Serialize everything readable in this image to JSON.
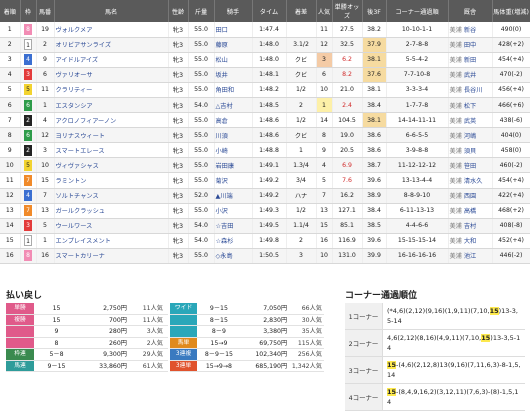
{
  "results": {
    "headers": [
      "着順",
      "枠",
      "馬番",
      "馬名",
      "性齢",
      "斤量",
      "騎手",
      "タイム",
      "着差",
      "人気",
      "単勝オッズ",
      "後3F",
      "コーナー通過順",
      "厩舎",
      "馬体重(増減)"
    ],
    "rows": [
      {
        "rank": "1",
        "waku": "8",
        "num": "19",
        "name": "ヴォルクメア",
        "sexage": "牝3",
        "weight": "55.0",
        "jockey": "田口",
        "time": "1:47.4",
        "margin": "",
        "pop": "11",
        "odds": "27.5",
        "last3f": "38.2",
        "corner": "10-10-1-1",
        "region": "美浦",
        "trainer": "新谷",
        "body": "490(0)"
      },
      {
        "rank": "2",
        "waku": "1",
        "num": "2",
        "name": "オリビアサンライズ",
        "sexage": "牝3",
        "weight": "55.0",
        "jockey": "藤原",
        "time": "1:48.0",
        "margin": "3.1/2",
        "pop": "12",
        "odds": "32.5",
        "last3f": "37.9",
        "corner": "2-7-8-8",
        "region": "美浦",
        "trainer": "田中",
        "body": "428(+2)"
      },
      {
        "rank": "3",
        "waku": "4",
        "num": "9",
        "name": "アイドルアイズ",
        "sexage": "牝3",
        "weight": "55.0",
        "jockey": "松山",
        "time": "1:48.0",
        "margin": "クビ",
        "pop": "3",
        "odds": "6.2",
        "last3f": "38.1",
        "corner": "5-5-4-2",
        "region": "美浦",
        "trainer": "新田",
        "body": "454(+4)"
      },
      {
        "rank": "4",
        "waku": "3",
        "num": "6",
        "name": "ヴァリオーサ",
        "sexage": "牝3",
        "weight": "55.0",
        "jockey": "坂井",
        "time": "1:48.1",
        "margin": "クビ",
        "pop": "6",
        "odds": "8.2",
        "last3f": "37.6",
        "corner": "7-7-10-8",
        "region": "美浦",
        "trainer": "武井",
        "body": "470(-2)"
      },
      {
        "rank": "5",
        "waku": "5",
        "num": "11",
        "name": "クラリティー",
        "sexage": "牝3",
        "weight": "55.0",
        "jockey": "角田和",
        "time": "1:48.2",
        "margin": "1/2",
        "pop": "10",
        "odds": "21.0",
        "last3f": "38.1",
        "corner": "3-3-3-4",
        "region": "美浦",
        "trainer": "長谷川",
        "body": "456(+4)"
      },
      {
        "rank": "6",
        "waku": "6",
        "num": "1",
        "name": "エスタンシア",
        "sexage": "牝3",
        "weight": "54.0",
        "jockey": "△吉村",
        "time": "1:48.5",
        "margin": "2",
        "pop": "1",
        "odds": "2.4",
        "last3f": "38.4",
        "corner": "1-7-7-8",
        "region": "美浦",
        "trainer": "松下",
        "body": "466(+6)"
      },
      {
        "rank": "7",
        "waku": "2",
        "num": "4",
        "name": "アクロノフィアーノン",
        "sexage": "牝3",
        "weight": "55.0",
        "jockey": "高倉",
        "time": "1:48.6",
        "margin": "1/2",
        "pop": "14",
        "odds": "104.5",
        "last3f": "38.1",
        "corner": "14-14-11-11",
        "region": "美浦",
        "trainer": "武英",
        "body": "438(-6)"
      },
      {
        "rank": "8",
        "waku": "6",
        "num": "12",
        "name": "ヨリナスウィート",
        "sexage": "牝3",
        "weight": "55.0",
        "jockey": "川須",
        "time": "1:48.6",
        "margin": "クビ",
        "pop": "8",
        "odds": "19.0",
        "last3f": "38.6",
        "corner": "6-6-5-5",
        "region": "美浦",
        "trainer": "河嶋",
        "body": "404(0)"
      },
      {
        "rank": "9",
        "waku": "2",
        "num": "3",
        "name": "スマートエレース",
        "sexage": "牝3",
        "weight": "55.0",
        "jockey": "小崎",
        "time": "1:48.8",
        "margin": "1",
        "pop": "9",
        "odds": "20.5",
        "last3f": "38.6",
        "corner": "3-9-8-8",
        "region": "美浦",
        "trainer": "須貝",
        "body": "458(0)"
      },
      {
        "rank": "10",
        "waku": "5",
        "num": "10",
        "name": "ヴィヴァシャス",
        "sexage": "牝3",
        "weight": "55.0",
        "jockey": "岩田康",
        "time": "1:49.1",
        "margin": "1.3/4",
        "pop": "4",
        "odds": "6.9",
        "last3f": "38.7",
        "corner": "11-12-12-12",
        "region": "美浦",
        "trainer": "笹田",
        "body": "460(-2)"
      },
      {
        "rank": "11",
        "waku": "7",
        "num": "15",
        "name": "ラミントン",
        "sexage": "牝3",
        "weight": "55.0",
        "jockey": "菊沢",
        "time": "1:49.2",
        "margin": "3/4",
        "pop": "5",
        "odds": "7.6",
        "last3f": "39.6",
        "corner": "13-13-4-4",
        "region": "美浦",
        "trainer": "清水久",
        "body": "454(+4)"
      },
      {
        "rank": "12",
        "waku": "4",
        "num": "7",
        "name": "ソルトチャンス",
        "sexage": "牝3",
        "weight": "52.0",
        "jockey": "▲川端",
        "time": "1:49.2",
        "margin": "ハナ",
        "pop": "7",
        "odds": "16.2",
        "last3f": "38.9",
        "corner": "8-8-9-10",
        "region": "美浦",
        "trainer": "西園",
        "body": "422(+4)"
      },
      {
        "rank": "13",
        "waku": "7",
        "num": "13",
        "name": "ガールクラッシュ",
        "sexage": "牝3",
        "weight": "55.0",
        "jockey": "小沢",
        "time": "1:49.3",
        "margin": "1/2",
        "pop": "13",
        "odds": "127.1",
        "last3f": "38.4",
        "corner": "6-11-13-13",
        "region": "美浦",
        "trainer": "高橋",
        "body": "468(+2)"
      },
      {
        "rank": "14",
        "waku": "3",
        "num": "5",
        "name": "ウールワース",
        "sexage": "牝3",
        "weight": "54.0",
        "jockey": "☆吉田",
        "time": "1:49.5",
        "margin": "1.1/4",
        "pop": "15",
        "odds": "85.1",
        "last3f": "38.5",
        "corner": "4-4-6-6",
        "region": "美浦",
        "trainer": "吉村",
        "body": "408(-8)"
      },
      {
        "rank": "15",
        "waku": "1",
        "num": "1",
        "name": "エンプレイスメント",
        "sexage": "牝3",
        "weight": "54.0",
        "jockey": "☆森杉",
        "time": "1:49.8",
        "margin": "2",
        "pop": "16",
        "odds": "116.9",
        "last3f": "39.6",
        "corner": "15-15-15-14",
        "region": "美浦",
        "trainer": "大和",
        "body": "452(+4)"
      },
      {
        "rank": "16",
        "waku": "8",
        "num": "16",
        "name": "スマートカリーナ",
        "sexage": "牝3",
        "weight": "55.0",
        "jockey": "◇永島",
        "time": "1:50.5",
        "margin": "3",
        "pop": "10",
        "odds": "131.0",
        "last3f": "39.9",
        "corner": "16-16-16-16",
        "region": "美浦",
        "trainer": "池江",
        "body": "446(-2)"
      }
    ]
  },
  "payout_title": "払い戻し",
  "payouts_left": [
    {
      "type": "単勝",
      "color": "#e05a8a",
      "comb": "15",
      "amount": "2,750円",
      "pop": "11人気"
    },
    {
      "type": "複勝",
      "color": "#e05a8a",
      "comb": "15",
      "amount": "700円",
      "pop": "11人気"
    },
    {
      "type": "",
      "color": "#e05a8a",
      "comb": "9",
      "amount": "280円",
      "pop": "3人気"
    },
    {
      "type": "",
      "color": "#e05a8a",
      "comb": "8",
      "amount": "260円",
      "pop": "2人気"
    },
    {
      "type": "枠連",
      "color": "#3a8a4f",
      "comb": "5－8",
      "amount": "9,300円",
      "pop": "29人気"
    },
    {
      "type": "馬連",
      "color": "#2e9c9a",
      "comb": "9－15",
      "amount": "33,860円",
      "pop": "61人気"
    }
  ],
  "payouts_right": [
    {
      "type": "ワイド",
      "color": "#2aa7b9",
      "comb": "9－15",
      "amount": "7,050円",
      "pop": "66人気"
    },
    {
      "type": "",
      "color": "#2aa7b9",
      "comb": "8－15",
      "amount": "2,830円",
      "pop": "30人気"
    },
    {
      "type": "",
      "color": "#2aa7b9",
      "comb": "8－9",
      "amount": "3,380円",
      "pop": "35人気"
    },
    {
      "type": "馬単",
      "color": "#e08a1e",
      "comb": "15→9",
      "amount": "69,750円",
      "pop": "115人気"
    },
    {
      "type": "3連複",
      "color": "#3a7ac0",
      "comb": "8－9－15",
      "amount": "102,340円",
      "pop": "256人気"
    },
    {
      "type": "3連単",
      "color": "#e0522c",
      "comb": "15→9→8",
      "amount": "685,190円",
      "pop": "1,342人気"
    }
  ],
  "corner_title": "コーナー通過順位",
  "corners": [
    {
      "label": "1コーナー",
      "lead": "",
      "pre": "(*4,6)(2,12)(9,16)(1,9,11)(7,10,",
      "text": "15",
      "post": ")13-3,5-14"
    },
    {
      "label": "2コーナー",
      "lead": "",
      "pre": "4,6(2,12)(8,16)(4,9,11)(7,10,",
      "text": "15",
      "post": ")13-3,5-14"
    },
    {
      "label": "3コーナー",
      "lead": "15",
      "pre": "",
      "text": "",
      "post": "-(4,6)(2,12,8)13(9,16)(7,11,6,3)-8-1,5,14"
    },
    {
      "label": "4コーナー",
      "lead": "15",
      "pre": "",
      "text": "",
      "post": "-(8,4,9,16,2)(3,12,11)(7,6,3)-(8)-1,5,14"
    }
  ],
  "colors": {
    "waku1": "#ffffff",
    "waku2": "#222222",
    "waku3": "#e33b3b",
    "waku4": "#3b6fd1",
    "waku5": "#f2d330",
    "waku6": "#2e9c4a",
    "waku7": "#f08a2a",
    "waku8": "#f28cb4"
  }
}
